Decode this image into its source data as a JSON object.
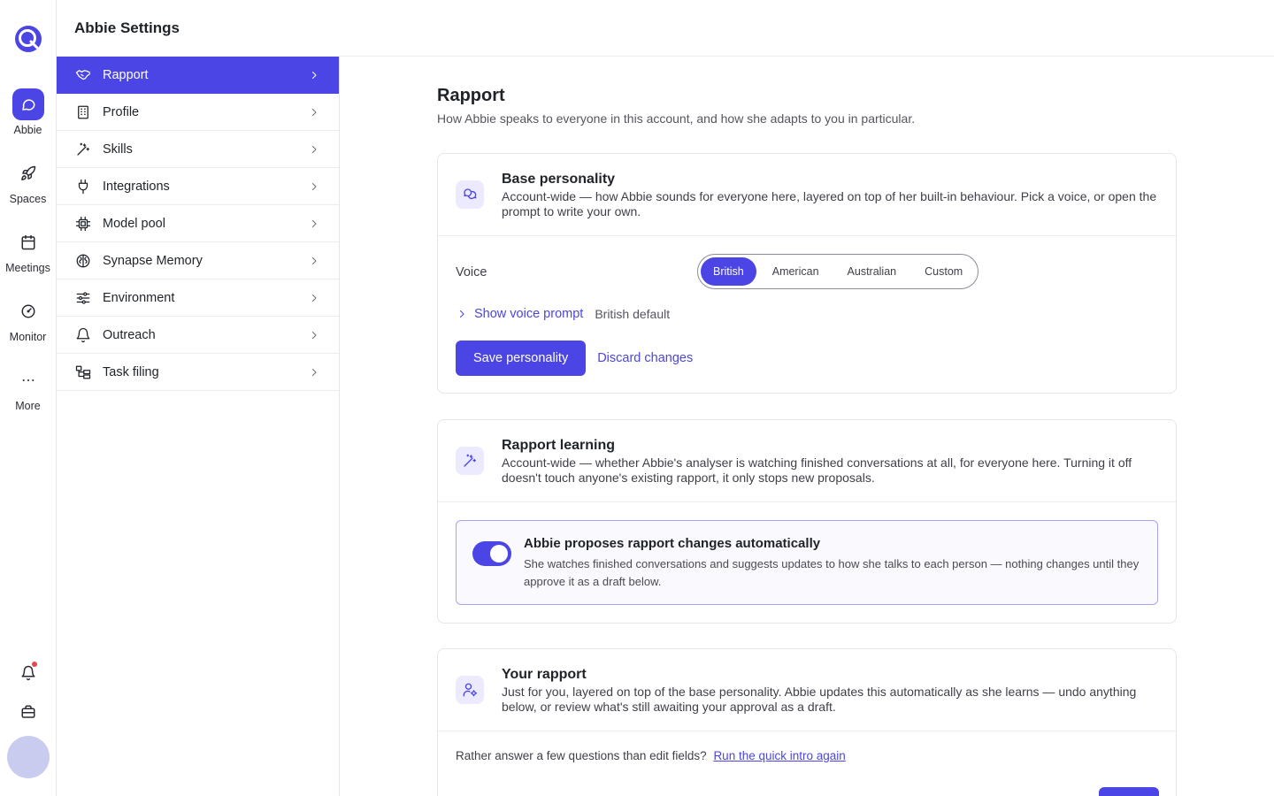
{
  "rail": {
    "items": [
      {
        "label": "Abbie",
        "icon": "chat-bubble-icon",
        "active": true
      },
      {
        "label": "Spaces",
        "icon": "rocket-icon",
        "active": false
      },
      {
        "label": "Meetings",
        "icon": "calendar-icon",
        "active": false
      },
      {
        "label": "Monitor",
        "icon": "gauge-icon",
        "active": false
      },
      {
        "label": "More",
        "icon": "ellipsis-icon",
        "active": false
      }
    ],
    "bottom_icons": [
      "bell-icon",
      "briefcase-icon"
    ],
    "colors": {
      "accent": "#4b45e6",
      "notification": "#e5484d",
      "avatar": "#c9cbef"
    }
  },
  "header": {
    "title": "Abbie Settings"
  },
  "menu": {
    "items": [
      {
        "label": "Rapport",
        "icon": "handshake-icon",
        "active": true
      },
      {
        "label": "Profile",
        "icon": "building-icon",
        "active": false
      },
      {
        "label": "Skills",
        "icon": "magic-wand-icon",
        "active": false
      },
      {
        "label": "Integrations",
        "icon": "plug-icon",
        "active": false
      },
      {
        "label": "Model pool",
        "icon": "cpu-chip-icon",
        "active": false
      },
      {
        "label": "Synapse Memory",
        "icon": "brain-icon",
        "active": false
      },
      {
        "label": "Environment",
        "icon": "sliders-icon",
        "active": false
      },
      {
        "label": "Outreach",
        "icon": "bell-icon",
        "active": false
      },
      {
        "label": "Task filing",
        "icon": "hierarchy-icon",
        "active": false
      }
    ]
  },
  "main": {
    "title": "Rapport",
    "subtitle": "How Abbie speaks to everyone in this account, and how she adapts to you in particular.",
    "base_personality": {
      "title": "Base personality",
      "description": "Account-wide — how Abbie sounds for everyone here, layered on top of her built-in behaviour. Pick a voice, or open the prompt to write your own.",
      "voice_label": "Voice",
      "voice_options": [
        "British",
        "American",
        "Australian",
        "Custom"
      ],
      "voice_selected": "British",
      "show_prompt_label": "Show voice prompt",
      "prompt_value": "British default",
      "save_label": "Save personality",
      "discard_label": "Discard changes"
    },
    "rapport_learning": {
      "title": "Rapport learning",
      "description": "Account-wide — whether Abbie's analyser is watching finished conversations at all, for everyone here. Turning it off doesn't touch anyone's existing rapport, it only stops new proposals.",
      "toggle_title": "Abbie proposes rapport changes automatically",
      "toggle_description": "She watches finished conversations and suggests updates to how she talks to each person — nothing changes until they approve it as a draft below.",
      "toggle_on": true
    },
    "your_rapport": {
      "title": "Your rapport",
      "description": "Just for you, layered on top of the base personality. Abbie updates this automatically as she learns — undo anything below, or review what's still awaiting your approval as a draft.",
      "intro_prompt": "Rather answer a few questions than edit fields?",
      "intro_link": "Run the quick intro again"
    }
  }
}
